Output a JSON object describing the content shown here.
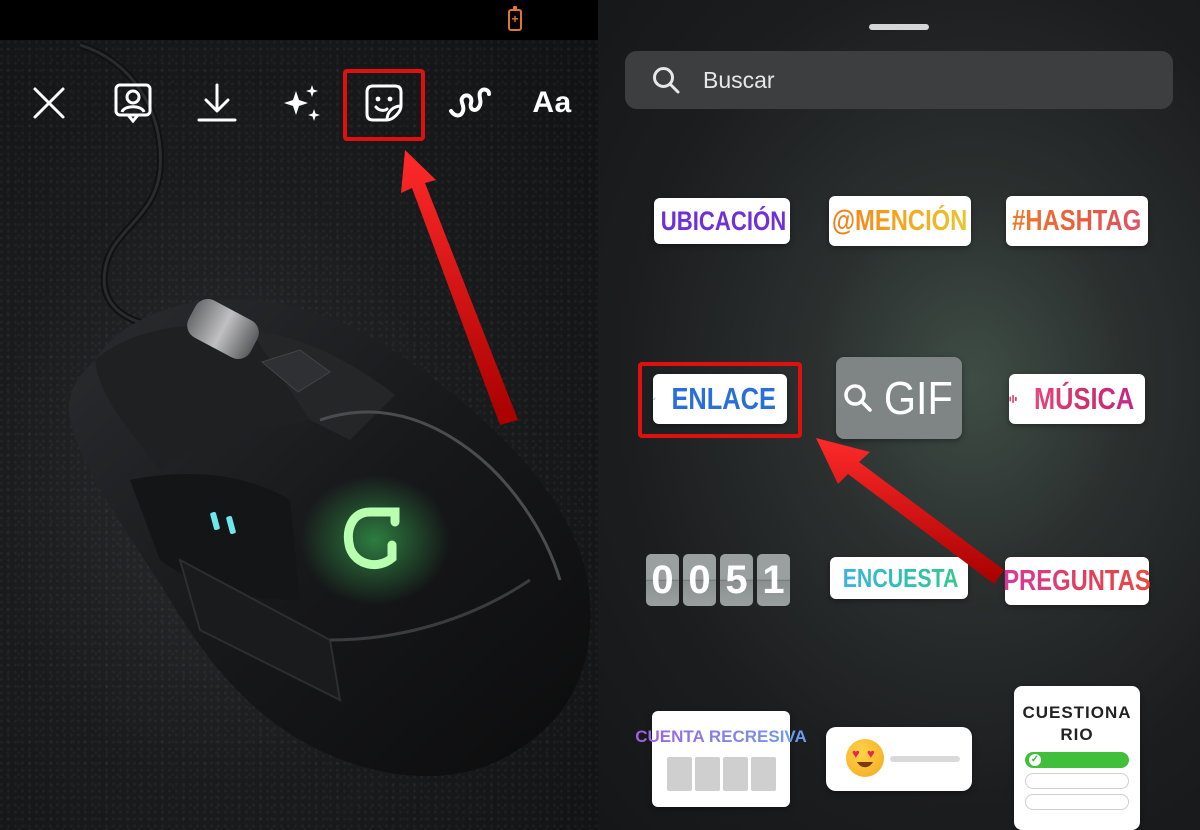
{
  "toolbar": {
    "items": [
      {
        "name": "close",
        "icon": "close-icon"
      },
      {
        "name": "tag-people",
        "icon": "person-tag-icon"
      },
      {
        "name": "download",
        "icon": "download-icon"
      },
      {
        "name": "effects",
        "icon": "sparkles-icon"
      },
      {
        "name": "stickers",
        "icon": "sticker-icon",
        "highlighted": true
      },
      {
        "name": "draw",
        "icon": "scribble-icon"
      },
      {
        "name": "text",
        "icon": "text-icon"
      }
    ],
    "text_label": "Aa"
  },
  "status_bar": {
    "battery": "charging",
    "battery_color": "#e2762f"
  },
  "sticker_tray": {
    "search": {
      "placeholder": "Buscar"
    },
    "stickers": {
      "location": "UBICACIÓN",
      "mention": "@MENCIÓN",
      "hashtag": "#HASHTAG",
      "link": "ENLACE",
      "gif": "GIF",
      "music": "MÚSICA",
      "countdown_digits": [
        "0",
        "0",
        "5",
        "1"
      ],
      "poll": "ENCUESTA",
      "questions": "PREGUNTAS",
      "countdown_title": "CUENTA RECRESIVA",
      "quiz_title": "CUESTIONARIO"
    },
    "highlighted_sticker": "link"
  },
  "colors": {
    "highlight": "#e01010",
    "location": "#7030d8",
    "link": "#2a6fd8",
    "quiz_correct": "#3fbf3a"
  }
}
